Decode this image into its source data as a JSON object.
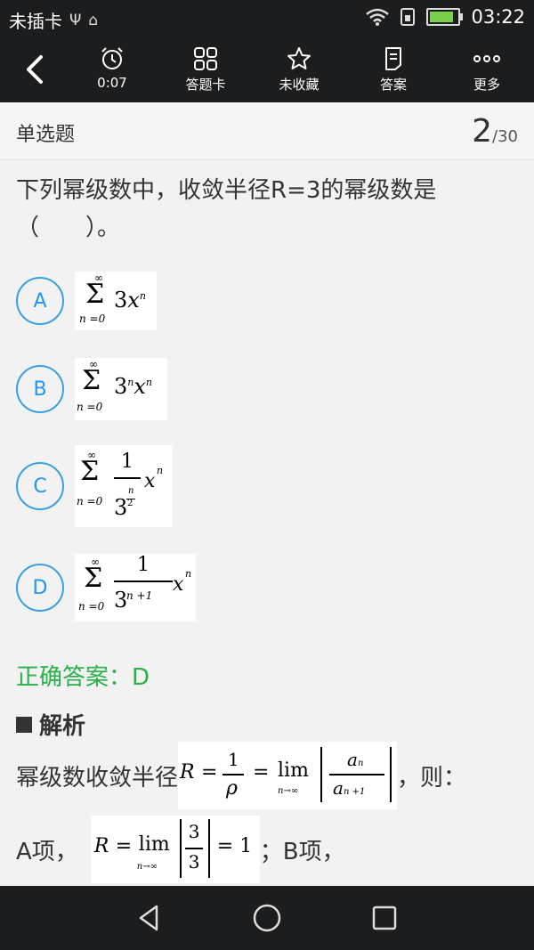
{
  "status_bar": {
    "carrier": "未插卡",
    "time": "03:22"
  },
  "toolbar": {
    "timer": "0:07",
    "answer_card": "答题卡",
    "favorite": "未收藏",
    "answer": "答案",
    "more": "更多"
  },
  "question": {
    "type": "单选题",
    "current": "2",
    "total": "/30",
    "stem": "下列幂级数中，收敛半径R=3的幂级数是（　　）。",
    "options": [
      {
        "letter": "A"
      },
      {
        "letter": "B"
      },
      {
        "letter": "C"
      },
      {
        "letter": "D"
      }
    ]
  },
  "answer": {
    "text": "正确答案：D"
  },
  "analysis": {
    "title": "解析",
    "line1_prefix": "幂级数收敛半径",
    "line1_suffix": "，则：",
    "line2_prefix": "A项，",
    "line2_suffix": "；B项，"
  }
}
